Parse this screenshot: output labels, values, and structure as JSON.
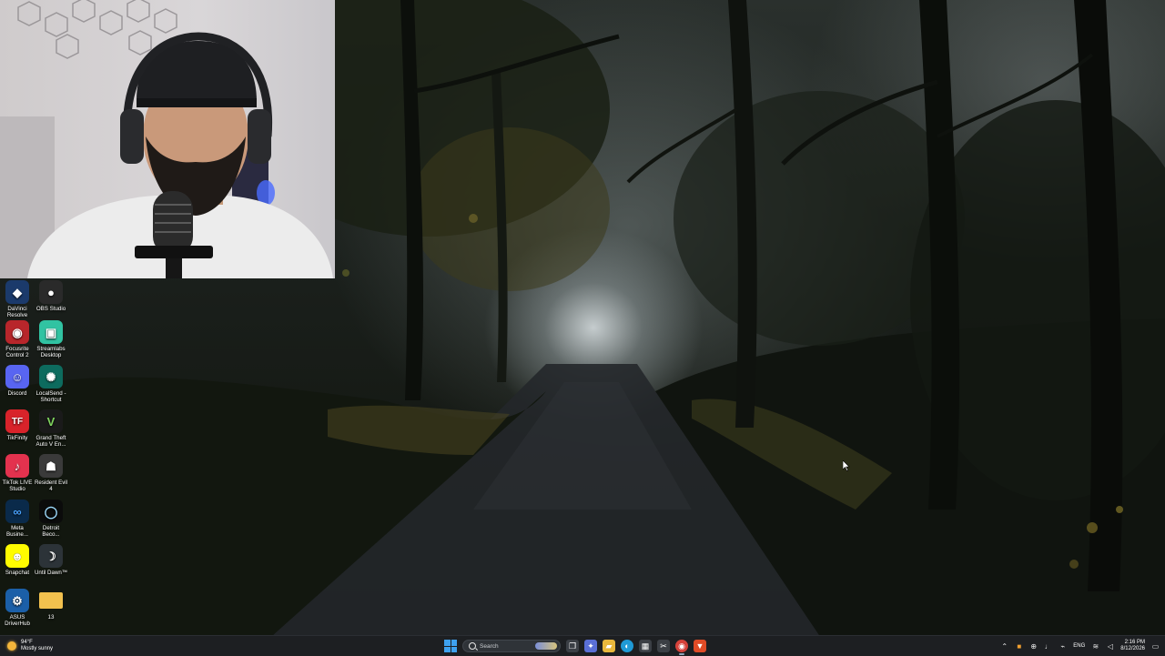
{
  "desktop": {
    "icons": [
      {
        "label": "DaVinci Resolve",
        "icon": "davinci-resolve-icon",
        "color": "#1b3a6b",
        "glyph": "◆"
      },
      {
        "label": "OBS Studio",
        "icon": "obs-studio-icon",
        "color": "#2a2a2a",
        "glyph": "●"
      },
      {
        "label": "Focusrite Control 2",
        "icon": "focusrite-icon",
        "color": "#b8262b",
        "glyph": "◉"
      },
      {
        "label": "Streamlabs Desktop",
        "icon": "streamlabs-icon",
        "color": "#31c3a2",
        "glyph": "▣"
      },
      {
        "label": "Discord",
        "icon": "discord-icon",
        "color": "#5865f2",
        "glyph": "☺"
      },
      {
        "label": "LocalSend - Shortcut",
        "icon": "localsend-icon",
        "color": "#0d6b5e",
        "glyph": "✺"
      },
      {
        "label": "TikFinity",
        "icon": "tikfinity-icon",
        "color": "#d8232a",
        "glyph": "TF"
      },
      {
        "label": "Grand Theft Auto V En...",
        "icon": "gta-v-icon",
        "color": "#1a1a1a",
        "glyph": "V"
      },
      {
        "label": "TikTok LIVE Studio",
        "icon": "tiktok-live-icon",
        "color": "#e3324e",
        "glyph": "♪"
      },
      {
        "label": "Resident Evil 4",
        "icon": "resident-evil-icon",
        "color": "#3a3a3a",
        "glyph": "☗"
      },
      {
        "label": "Meta Busine...",
        "icon": "meta-business-icon",
        "color": "#0a2a4a",
        "glyph": "∞"
      },
      {
        "label": "Detroit Beco...",
        "icon": "detroit-icon",
        "color": "#0b0b0b",
        "glyph": "◯"
      },
      {
        "label": "Snapchat",
        "icon": "snapchat-icon",
        "color": "#fffc00",
        "glyph": "👻"
      },
      {
        "label": "Until Dawn™",
        "icon": "until-dawn-icon",
        "color": "#2c3338",
        "glyph": "☽"
      },
      {
        "label": "ASUS DriverHub",
        "icon": "asus-driverhub-icon",
        "color": "#1b5fa8",
        "glyph": "⚙"
      },
      {
        "label": "13",
        "icon": "folder-icon",
        "color": "#f2c14e",
        "glyph": "▬"
      }
    ]
  },
  "taskbar": {
    "weather_temp": "94°F",
    "weather_desc": "Mostly sunny",
    "search_placeholder": "Search",
    "apps": [
      {
        "icon": "task-view-icon",
        "glyph": "❐",
        "color": "#3b3f45"
      },
      {
        "icon": "copilot-icon",
        "glyph": "✦",
        "color": "#5a6fd6"
      },
      {
        "icon": "file-explorer-icon",
        "glyph": "▰",
        "color": "#e9b83c"
      },
      {
        "icon": "edge-icon",
        "glyph": "◐",
        "color": "#1f9ad6"
      },
      {
        "icon": "microsoft-store-icon",
        "glyph": "▦",
        "color": "#3b3f45"
      },
      {
        "icon": "snipping-tool-icon",
        "glyph": "✂",
        "color": "#3b3f45"
      },
      {
        "icon": "chrome-icon",
        "glyph": "◉",
        "color": "#d6423a"
      },
      {
        "icon": "brave-icon",
        "glyph": "▼",
        "color": "#e04b26"
      }
    ],
    "language": "ENG",
    "time": "2:16 PM",
    "date": "8/12/2026"
  }
}
